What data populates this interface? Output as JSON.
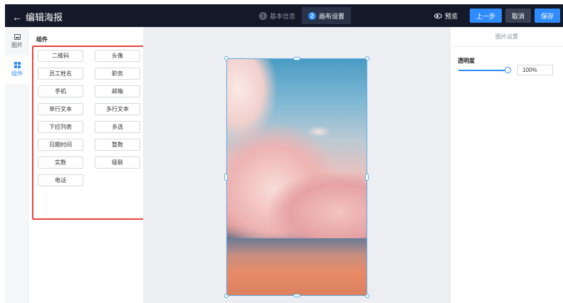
{
  "header": {
    "title": "编辑海报",
    "steps": [
      {
        "num": "1",
        "label": "基本信息"
      },
      {
        "num": "2",
        "label": "画布设置"
      }
    ],
    "preview_label": "预览",
    "prev_label": "上一步",
    "cancel_label": "取消",
    "save_label": "保存"
  },
  "rail": {
    "items": [
      {
        "label": "图片",
        "icon": "image-icon"
      },
      {
        "label": "组件",
        "icon": "grid-icon"
      }
    ]
  },
  "components": {
    "title": "组件",
    "items": [
      "二维码",
      "头像",
      "员工姓名",
      "职务",
      "手机",
      "邮箱",
      "单行文本",
      "多行文本",
      "下拉列表",
      "多选",
      "日期时间",
      "整数",
      "实数",
      "级联",
      "电话"
    ]
  },
  "properties": {
    "header": "图片设置",
    "opacity_label": "透明度",
    "opacity_value": "100%"
  },
  "colors": {
    "topbar": "#14192a",
    "accent": "#2f8cff",
    "highlight_border": "#e5453a"
  }
}
